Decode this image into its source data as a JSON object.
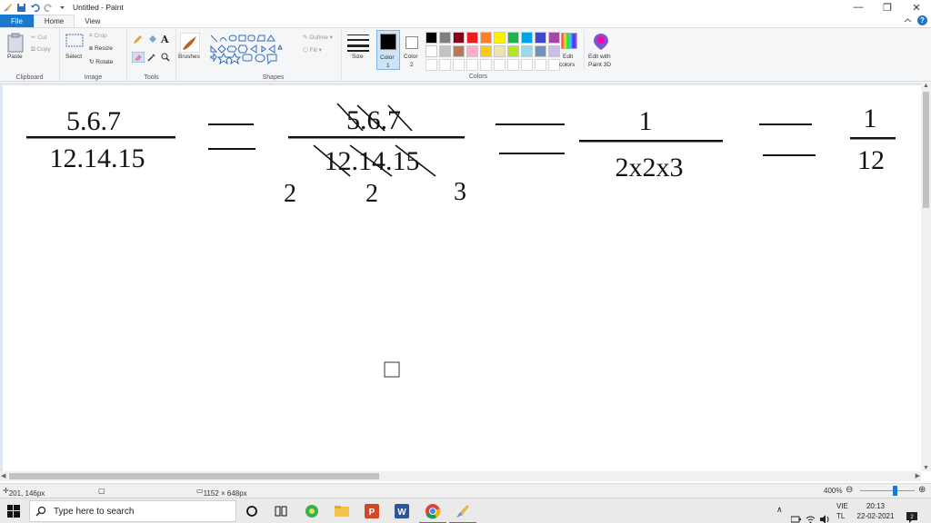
{
  "window": {
    "title": "Untitled - Paint",
    "controls": {
      "minimize": "—",
      "maximize": "❐",
      "close": "✕"
    }
  },
  "tabs": [
    {
      "label": "File"
    },
    {
      "label": "Home"
    },
    {
      "label": "View"
    }
  ],
  "ribbon": {
    "clipboard": {
      "paste": "Paste",
      "cut": "Cut",
      "copy": "Copy",
      "group": "Clipboard"
    },
    "image": {
      "select": "Select",
      "crop": "Crop",
      "resize": "Resize",
      "rotate": "Rotate",
      "group": "Image"
    },
    "tools": {
      "group": "Tools"
    },
    "brushes": {
      "label": "Brushes"
    },
    "shapes": {
      "outline": "Outline",
      "fill": "Fill",
      "group": "Shapes"
    },
    "size": {
      "label": "Size"
    },
    "color1": {
      "label": "Color",
      "sub": "1"
    },
    "color2": {
      "label": "Color",
      "sub": "2"
    },
    "colors_group": "Colors",
    "edit_colors": {
      "line1": "Edit",
      "line2": "colors"
    },
    "paint3d": {
      "line1": "Edit with",
      "line2": "Paint 3D"
    },
    "palette_row1": [
      "#000000",
      "#7f7f7f",
      "#880015",
      "#ed1c24",
      "#ff7f27",
      "#fff200",
      "#22b14c",
      "#00a2e8",
      "#3f48cc",
      "#a349a4"
    ],
    "palette_row2": [
      "#ffffff",
      "#c3c3c3",
      "#b97a57",
      "#ffaec9",
      "#ffc90e",
      "#efe4b0",
      "#b5e61d",
      "#99d9ea",
      "#7092be",
      "#c8bfe7"
    ],
    "palette_row3": [
      "#ffffff",
      "#ffffff",
      "#ffffff",
      "#ffffff",
      "#ffffff",
      "#ffffff",
      "#ffffff",
      "#ffffff",
      "#ffffff",
      "#ffffff"
    ]
  },
  "canvas_content": {
    "frac1_num": "5.6.7",
    "frac1_den": "12.14.15",
    "frac2_num": "5.6.7",
    "frac2_den": "12.14.15",
    "sub_2a": "2",
    "sub_2b": "2",
    "sub_3": "3",
    "frac3_num": "1",
    "frac3_den": "2x2x3",
    "frac4_num": "1",
    "frac4_den": "12"
  },
  "status": {
    "cursor": "201, 146px",
    "canvas_size": "1152 × 648px",
    "zoom": "400%"
  },
  "taskbar": {
    "search_placeholder": "Type here to search",
    "lang_line1": "VIE",
    "lang_line2": "TL",
    "time": "20:13",
    "date": "22-02-2021"
  }
}
